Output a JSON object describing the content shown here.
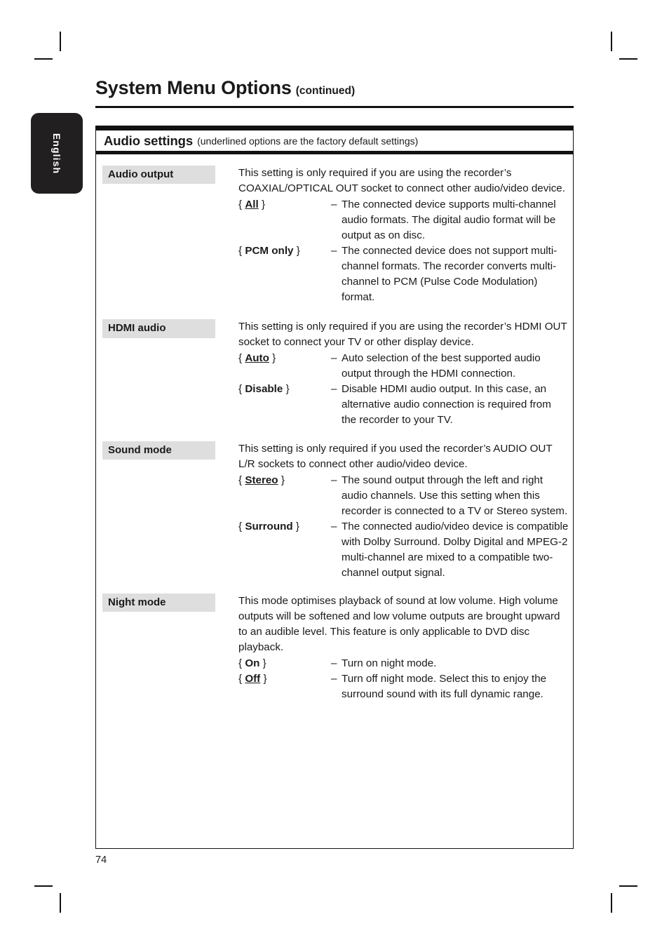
{
  "page": {
    "title": "System Menu Options",
    "title_continued": "(continued)",
    "language_tab": "English",
    "page_number": "74"
  },
  "section": {
    "heading": "Audio settings",
    "note": "(underlined options are the factory default settings)"
  },
  "settings": [
    {
      "label": "Audio output",
      "intro": "This setting is only required if you are using the recorder’s COAXIAL/OPTICAL OUT socket to connect other audio/video device.",
      "options": [
        {
          "open_brace": "{",
          "name": "All",
          "underlined": true,
          "close_brace": "}",
          "dash": "–",
          "description": "The connected device supports multi-channel audio formats.  The digital audio format will be output as on disc."
        },
        {
          "open_brace": "{",
          "name": "PCM only",
          "underlined": false,
          "close_brace": "}",
          "dash": "–",
          "description": "The connected device does not support multi-channel formats.  The recorder converts multi-channel to PCM (Pulse Code Modulation) format."
        }
      ]
    },
    {
      "label": "HDMI audio",
      "intro": "This setting is only required if you are using the recorder’s HDMI OUT socket to connect your TV or other display device.",
      "options": [
        {
          "open_brace": "{",
          "name": "Auto",
          "underlined": true,
          "close_brace": "}",
          "dash": "–",
          "description": "Auto selection of the best supported audio output through the HDMI connection."
        },
        {
          "open_brace": "{",
          "name": "Disable",
          "underlined": false,
          "close_brace": "}",
          "dash": "–",
          "description": "Disable HDMI audio output.  In this case, an alternative audio connection is required from the recorder to your TV."
        }
      ]
    },
    {
      "label": "Sound mode",
      "intro": "This setting is only required if you used the recorder’s AUDIO OUT L/R sockets to connect other audio/video device.",
      "options": [
        {
          "open_brace": "{",
          "name": "Stereo",
          "underlined": true,
          "close_brace": "}",
          "dash": "–",
          "description": "The sound output through the left and right audio channels. Use this setting when this recorder is connected to a TV or Stereo system."
        },
        {
          "open_brace": "{",
          "name": "Surround",
          "underlined": false,
          "close_brace": "}",
          "dash": "–",
          "description": "The connected audio/video device is compatible with Dolby Surround. Dolby Digital and MPEG-2 multi-channel are mixed to a compatible two-channel output signal."
        }
      ]
    },
    {
      "label": "Night mode",
      "intro": "This mode optimises playback of sound at low volume. High volume outputs will be softened and low volume outputs are brought upward to an audible level.  This feature is only applicable to DVD disc playback.",
      "options": [
        {
          "open_brace": "{",
          "name": "On",
          "underlined": false,
          "close_brace": "}",
          "dash": "–",
          "description": "Turn on night mode."
        },
        {
          "open_brace": "{",
          "name": "Off",
          "underlined": true,
          "close_brace": "}",
          "dash": "–",
          "description": "Turn off night mode. Select this to enjoy the surround sound with its full dynamic range."
        }
      ]
    }
  ]
}
